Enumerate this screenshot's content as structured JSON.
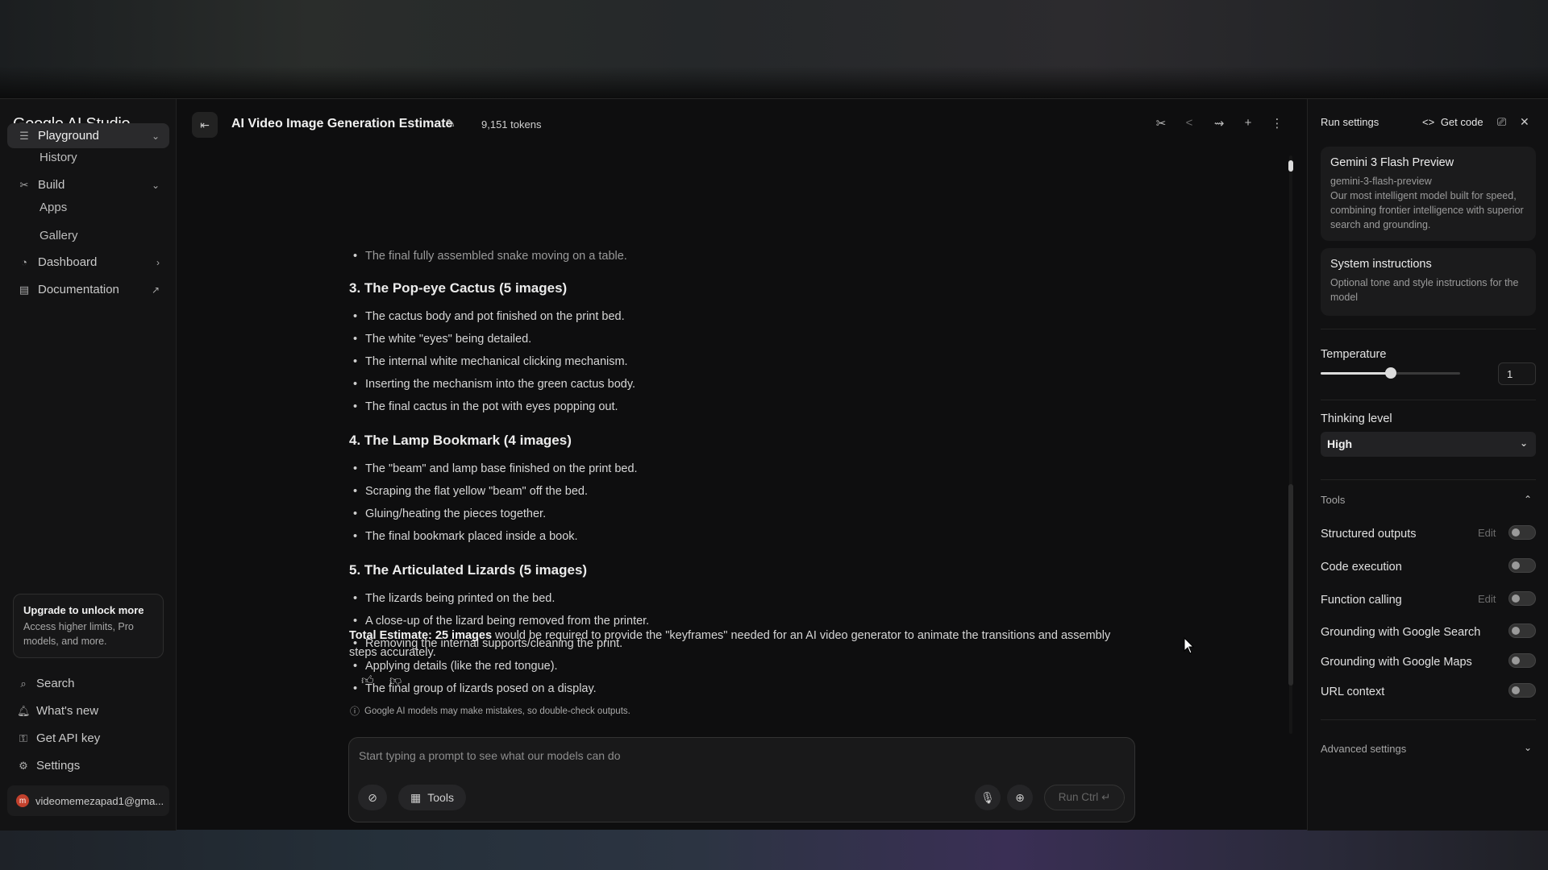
{
  "app": {
    "brand": "Google AI Studio",
    "chat_title": "AI Video Image Generation Estimate",
    "tokens": "9,151 tokens"
  },
  "sidebar": {
    "items": [
      {
        "label": "Playground",
        "icon": "playground-icon"
      },
      {
        "label": "History"
      },
      {
        "label": "Build",
        "icon": "build-icon"
      },
      {
        "label": "Apps"
      },
      {
        "label": "Gallery"
      },
      {
        "label": "Dashboard",
        "icon": "dashboard-icon"
      },
      {
        "label": "Documentation",
        "icon": "documentation-icon"
      }
    ],
    "upgrade": {
      "title": "Upgrade to unlock more",
      "desc": "Access higher limits, Pro models, and more."
    },
    "bottom": [
      {
        "label": "Search",
        "icon": "search-icon"
      },
      {
        "label": "What's new",
        "icon": "bell-icon"
      },
      {
        "label": "Get API key",
        "icon": "key-icon"
      },
      {
        "label": "Settings",
        "icon": "gear-icon"
      }
    ],
    "account": {
      "initial": "m",
      "email": "videomemezapad1@gma..."
    }
  },
  "content": {
    "prev_item": "The final fully assembled snake moving on a table.",
    "sections": [
      {
        "heading": "3. The Pop-eye Cactus (5 images)",
        "items": [
          "The cactus body and pot finished on the print bed.",
          "The white \"eyes\" being detailed.",
          "The internal white mechanical clicking mechanism.",
          "Inserting the mechanism into the green cactus body.",
          "The final cactus in the pot with eyes popping out."
        ]
      },
      {
        "heading": "4. The Lamp Bookmark (4 images)",
        "items": [
          "The \"beam\" and lamp base finished on the print bed.",
          "Scraping the flat yellow \"beam\" off the bed.",
          "Gluing/heating the pieces together.",
          "The final bookmark placed inside a book."
        ]
      },
      {
        "heading": "5. The Articulated Lizards (5 images)",
        "items": [
          "The lizards being printed on the bed.",
          "A close-up of the lizard being removed from the printer.",
          "Removing the internal supports/cleaning the print.",
          "Applying details (like the red tongue).",
          "The final group of lizards posed on a display."
        ]
      }
    ],
    "total_bold": "Total Estimate: 25 images",
    "total_rest": " would be required to provide the \"keyframes\" needed for an AI video generator to animate the transitions and assembly steps accurately.",
    "disclaimer": "Google AI models may make mistakes, so double-check outputs."
  },
  "prompt": {
    "placeholder": "Start typing a prompt to see what our models can do",
    "tools_label": "Tools",
    "run_label": "Run Ctrl ↵"
  },
  "run_settings": {
    "title": "Run settings",
    "get_code": "Get code",
    "model": {
      "name": "Gemini 3 Flash Preview",
      "id": "gemini-3-flash-preview",
      "desc": "Our most intelligent model built for speed, combining frontier intelligence with superior search and grounding."
    },
    "system": {
      "title": "System instructions",
      "desc": "Optional tone and style instructions for the model"
    },
    "temperature": {
      "label": "Temperature",
      "value": "1",
      "slider_fraction": 0.5
    },
    "thinking": {
      "label": "Thinking level",
      "value": "High"
    },
    "tools_header": "Tools",
    "tools": [
      {
        "label": "Structured outputs",
        "edit": "Edit",
        "enabled": false
      },
      {
        "label": "Code execution",
        "enabled": false
      },
      {
        "label": "Function calling",
        "edit": "Edit",
        "enabled": false
      },
      {
        "label": "Grounding with Google Search",
        "enabled": false
      },
      {
        "label": "Grounding with Google Maps",
        "enabled": false
      },
      {
        "label": "URL context",
        "enabled": false
      }
    ],
    "advanced": "Advanced settings"
  }
}
